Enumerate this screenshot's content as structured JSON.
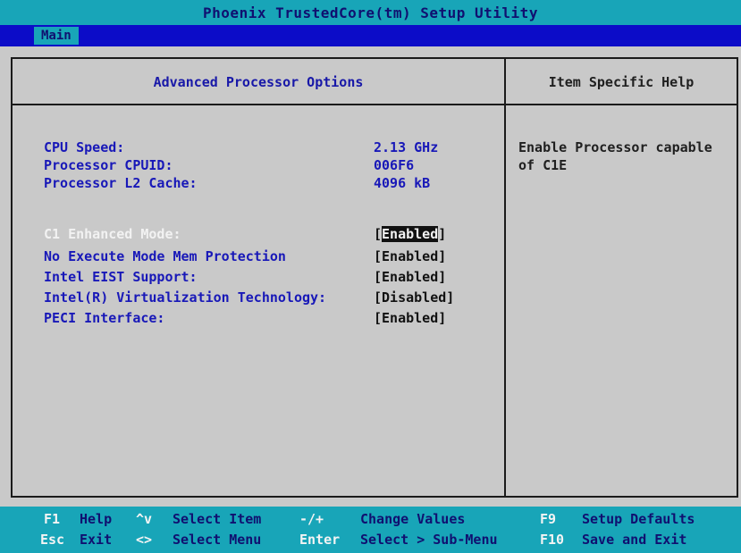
{
  "title": "Phoenix TrustedCore(tm) Setup Utility",
  "menu": {
    "active_tab": "Main"
  },
  "left_panel": {
    "title": "Advanced Processor Options",
    "info": [
      {
        "label": "CPU Speed:",
        "value": "2.13 GHz"
      },
      {
        "label": "Processor CPUID:",
        "value": "006F6"
      },
      {
        "label": "Processor L2 Cache:",
        "value": "4096 kB"
      }
    ],
    "options": [
      {
        "label": "C1 Enhanced Mode:",
        "value": "Enabled",
        "selected": true
      },
      {
        "label": "No Execute Mode Mem Protection",
        "value": "Enabled",
        "selected": false
      },
      {
        "label": "Intel EIST Support:",
        "value": "Enabled",
        "selected": false
      },
      {
        "label": "Intel(R) Virtualization Technology:",
        "value": "Disabled",
        "selected": false
      },
      {
        "label": "PECI Interface:",
        "value": "Enabled",
        "selected": false
      }
    ]
  },
  "right_panel": {
    "title": "Item Specific Help",
    "help_line1": "Enable Processor capable",
    "help_line2": "of C1E"
  },
  "footer": {
    "f1_key": "F1",
    "f1_desc": "Help",
    "updown_key": "^v",
    "updown_desc": "Select Item",
    "minusplus_key": "-/+",
    "minusplus_desc": "Change Values",
    "f9_key": "F9",
    "f9_desc": "Setup Defaults",
    "esc_key": "Esc",
    "esc_desc": "Exit",
    "leftright_key": "<>",
    "leftright_desc": "Select Menu",
    "enter_key": "Enter",
    "enter_desc": "Select > Sub-Menu",
    "f10_key": "F10",
    "f10_desc": "Save and Exit"
  },
  "colors": {
    "background": "#c9c9c9",
    "accent_cyan": "#18a5b8",
    "menubar_blue": "#0c0cc8",
    "label_blue": "#1818b8"
  }
}
